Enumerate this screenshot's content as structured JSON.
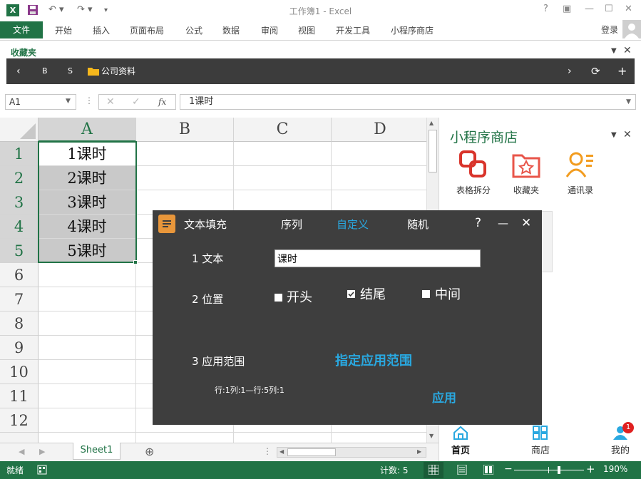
{
  "window": {
    "title": "工作簿1 - Excel"
  },
  "ribbon": {
    "file_tab": "文件",
    "tabs": [
      "开始",
      "插入",
      "页面布局",
      "公式",
      "数据",
      "审阅",
      "视图",
      "开发工具",
      "小程序商店"
    ],
    "login": "登录"
  },
  "favorites": {
    "label": "收藏夹",
    "b_label": "B",
    "s_label": "S",
    "folder": "公司资料"
  },
  "formula_bar": {
    "name_box": "A1",
    "formula": "1课时"
  },
  "grid": {
    "columns": [
      "A",
      "B",
      "C",
      "D"
    ],
    "rows": [
      "1",
      "2",
      "3",
      "4",
      "5",
      "6",
      "7",
      "8",
      "9",
      "10",
      "11",
      "12"
    ],
    "cells_a": [
      "1课时",
      "2课时",
      "3课时",
      "4课时",
      "5课时"
    ]
  },
  "sheet_tabs": {
    "active": "Sheet1"
  },
  "status_bar": {
    "ready": "就绪",
    "count": "计数: 5",
    "zoom": "190%"
  },
  "side_panel": {
    "title": "小程序商店",
    "apps": [
      {
        "label": "表格拆分",
        "icon": "split-table-icon"
      },
      {
        "label": "收藏夹",
        "icon": "favorites-folder-icon"
      },
      {
        "label": "通讯录",
        "icon": "contacts-icon"
      }
    ],
    "nav": [
      {
        "label": "首页",
        "icon": "home-icon"
      },
      {
        "label": "商店",
        "icon": "store-grid-icon"
      },
      {
        "label": "我的",
        "icon": "user-icon",
        "badge": "1"
      }
    ]
  },
  "dialog": {
    "title": "文本填充",
    "tabs": [
      "序列",
      "自定义",
      "随机"
    ],
    "active_tab": "自定义",
    "text_label": "1 文本",
    "text_value": "课时",
    "position_label": "2 位置",
    "options": [
      {
        "label": "开头",
        "checked": false
      },
      {
        "label": "结尾",
        "checked": true
      },
      {
        "label": "中间",
        "checked": false
      }
    ],
    "range_label": "3 应用范围",
    "range_link": "指定应用范围",
    "range_value": "行:1列:1—行:5列:1",
    "apply_button": "应用",
    "help": "?",
    "minimize": "—",
    "close": "✕"
  },
  "colors": {
    "excel_green": "#217346",
    "dialog_bg": "#3e3e3e",
    "accent_blue": "#29a8e0",
    "selection_gray": "#c9c9c9"
  }
}
